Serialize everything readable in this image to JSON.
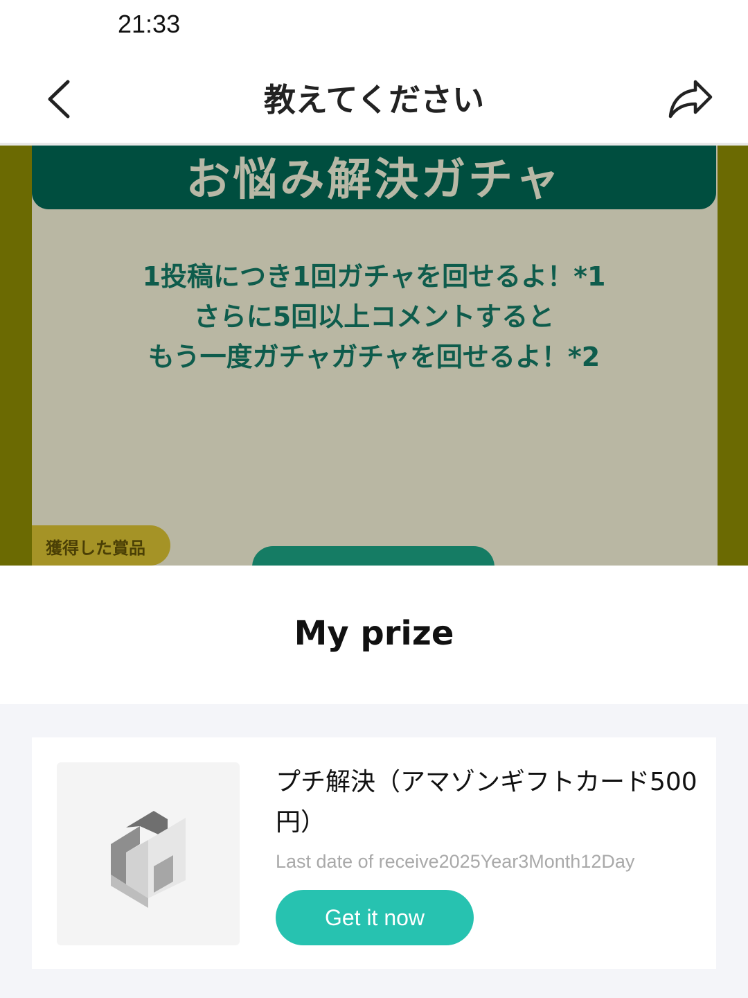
{
  "status_bar": {
    "time": "21:33"
  },
  "header": {
    "title": "教えてください",
    "back_icon": "chevron-left-icon",
    "share_icon": "share-arrow-icon"
  },
  "banner": {
    "heading": "お悩み解決ガチャ",
    "lines": [
      "1投稿につき1回ガチャを回せるよ！*1",
      "さらに5回以上コメントすると",
      "もう一度ガチャガチャを回せるよ！*2"
    ],
    "won_prizes_label": "獲得した賞品"
  },
  "prize_section": {
    "title": "My prize"
  },
  "prize_item": {
    "name": "プチ解決（アマゾンギフトカード500円）",
    "deadline": "Last date of receive2025Year3Month12Day",
    "button_label": "Get it now",
    "thumbnail_icon": "placeholder-cube-icon"
  },
  "colors": {
    "accent": "#27c2b0",
    "banner_header": "#004e3f",
    "banner_text": "#0e5c4c"
  }
}
